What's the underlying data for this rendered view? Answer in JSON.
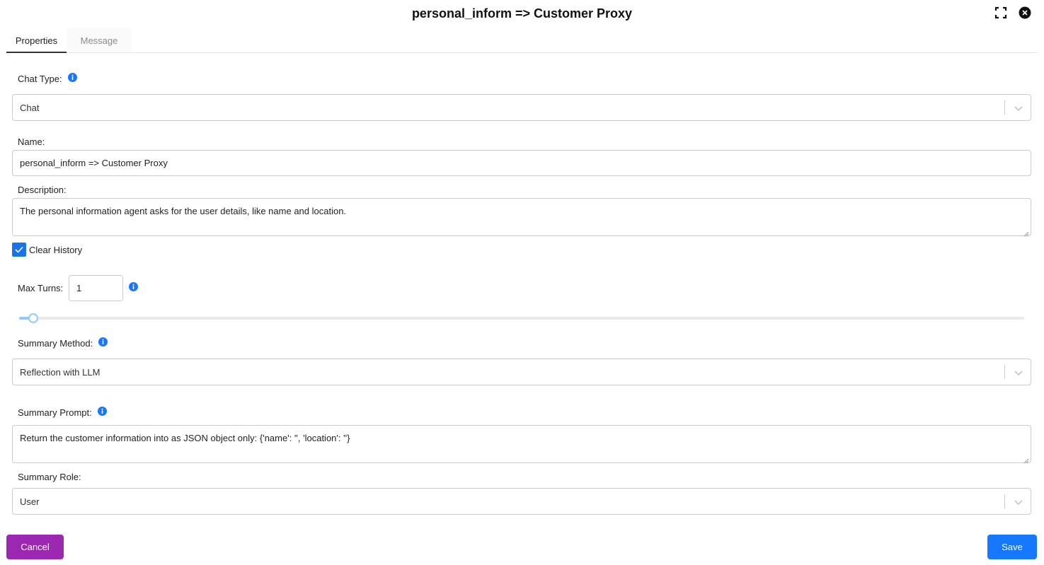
{
  "dialog": {
    "title": "personal_inform => Customer Proxy"
  },
  "tabs": [
    {
      "label": "Properties",
      "active": true
    },
    {
      "label": "Message",
      "active": false
    }
  ],
  "form": {
    "chat_type": {
      "label": "Chat Type:",
      "value": "Chat"
    },
    "name": {
      "label": "Name:",
      "value": "personal_inform => Customer Proxy"
    },
    "description": {
      "label": "Description:",
      "value": "The personal information agent asks for the user details, like name and location."
    },
    "clear_history": {
      "label": "Clear History",
      "checked": true
    },
    "max_turns": {
      "label": "Max Turns:",
      "value": "1",
      "slider_level": 0.01
    },
    "summary_method": {
      "label": "Summary Method:",
      "value": "Reflection with LLM"
    },
    "summary_prompt": {
      "label": "Summary Prompt:",
      "value": "Return the customer information into as JSON object only: {'name': '', 'location': ''}"
    },
    "summary_role": {
      "label": "Summary Role:",
      "value": "User"
    }
  },
  "footer": {
    "cancel_label": "Cancel",
    "save_label": "Save"
  },
  "colors": {
    "accent": "#1677ff",
    "cancel": "#9c27b0",
    "checkbox": "#1a73e8",
    "info": "#1677ff"
  },
  "icons": [
    "fullscreen-icon",
    "close-icon",
    "info-icon",
    "chevron-down-icon",
    "check-icon"
  ]
}
